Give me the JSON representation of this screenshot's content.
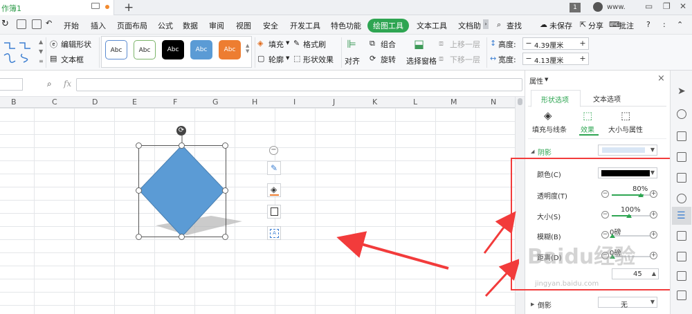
{
  "titlebar": {
    "tab_title": "作簿1",
    "new_tab": "+",
    "badge": "1",
    "user": "www."
  },
  "menu": {
    "items": [
      "开始",
      "插入",
      "页面布局",
      "公式",
      "数据",
      "审阅",
      "视图",
      "安全",
      "开发工具",
      "特色功能",
      "绘图工具",
      "文本工具",
      "文档助"
    ],
    "active": "绘图工具",
    "search": "查找",
    "unsaved": "未保存",
    "share": "分享",
    "comment": "批注",
    "help": "?",
    "more": ":"
  },
  "ribbon": {
    "edit_shape": "编辑形状",
    "text_box": "文本框",
    "styles": [
      "Abc",
      "Abc",
      "Abc",
      "Abc",
      "Abc"
    ],
    "fill": "填充",
    "format_brush": "格式刷",
    "outline": "轮廓",
    "shape_effects": "形状效果",
    "align": "对齐",
    "group": "组合",
    "rotate": "旋转",
    "selection_pane": "选择窗格",
    "bring_forward": "上移一层",
    "send_backward": "下移一层",
    "height_label": "高度:",
    "height_value": "4.39厘米",
    "width_label": "宽度:",
    "width_value": "4.13厘米",
    "minus": "−",
    "plus": "+"
  },
  "formula": {
    "fx": "fx"
  },
  "columns": [
    "B",
    "C",
    "D",
    "E",
    "F",
    "G",
    "H",
    "I",
    "J",
    "K",
    "L",
    "M",
    "N"
  ],
  "panel": {
    "title": "属性",
    "tab_shape": "形状选项",
    "tab_text": "文本选项",
    "sub_fill": "填充与线条",
    "sub_effect": "效果",
    "sub_size": "大小与属性",
    "section_shadow": "阴影",
    "color_label": "颜色(C)",
    "transparency_label": "透明度(T)",
    "transparency_value": "80%",
    "size_label": "大小(S)",
    "size_value": "100%",
    "blur_label": "模糊(B)",
    "blur_value": "0磅",
    "distance_label": "距离(D)",
    "distance_value": "0磅",
    "reflection_label": "倒影",
    "reflection_value": "无",
    "angle_value": "45",
    "close": "×"
  },
  "watermark": {
    "text": "Baidu经验",
    "sub": "jingyan.baidu.com"
  },
  "colors": {
    "accent": "#2ea552",
    "shape_fill": "#5b9bd5",
    "annotation": "#f23b3b"
  },
  "values": {
    "transparency": 80,
    "size": 100,
    "blur": 0,
    "distance": 0
  }
}
